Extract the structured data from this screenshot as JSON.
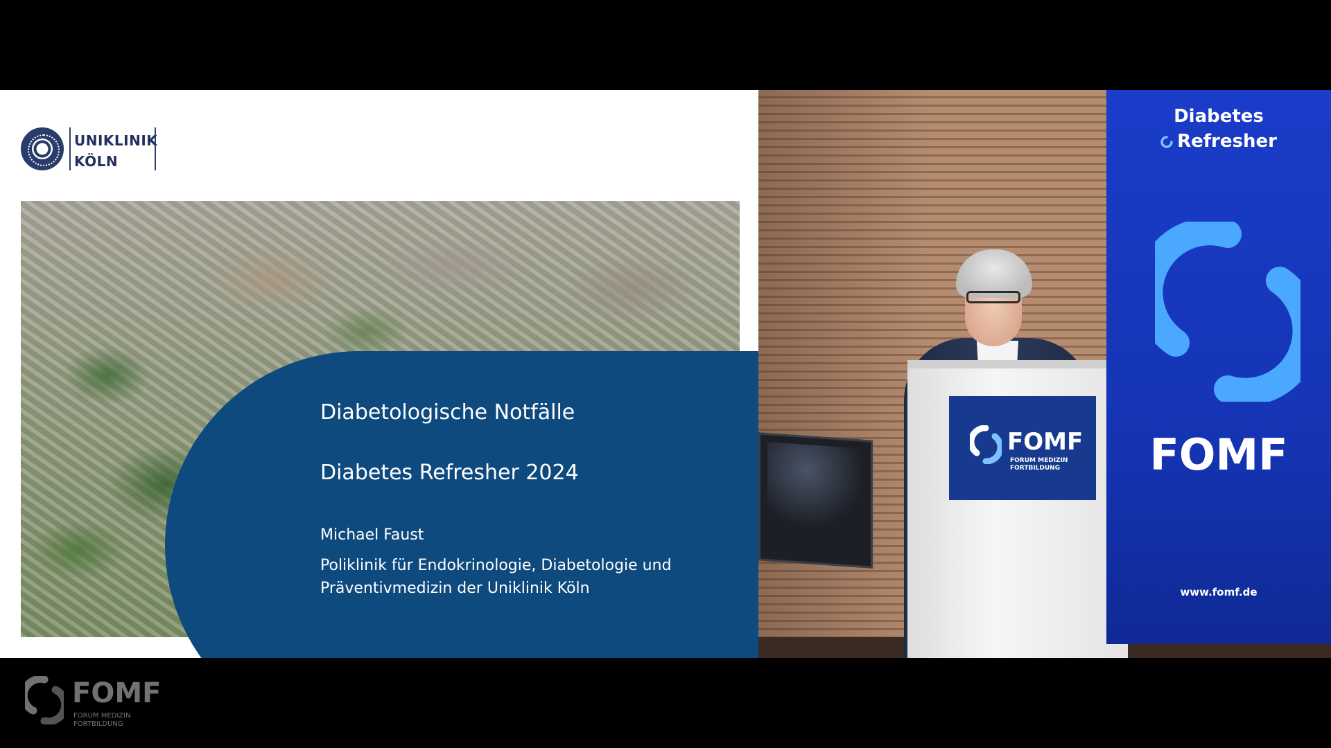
{
  "slide": {
    "institution_line1": "UNIKLINIK",
    "institution_line2": "KÖLN",
    "title": "Diabetologische Notfälle",
    "subtitle": "Diabetes Refresher 2024",
    "presenter": "Michael Faust",
    "affiliation": "Poliklinik für Endokrinologie, Diabetologie und Präventivmedizin der Uniklinik Köln",
    "panel_color": "#0e4a7e"
  },
  "video": {
    "banner_title_line1": "Diabetes",
    "banner_title_line2": "Refresher",
    "banner_brand": "FOMF",
    "banner_url": "www.fomf.de",
    "podium_brand": "FOMF",
    "podium_sub_line1": "FORUM MEDIZIN",
    "podium_sub_line2": "FORTBILDUNG",
    "banner_color": "#1a3cc9",
    "ring_color_light": "#3aa0ff"
  },
  "watermark": {
    "brand": "FOMF",
    "sub_line1": "FORUM MEDIZIN",
    "sub_line2": "FORTBILDUNG"
  }
}
